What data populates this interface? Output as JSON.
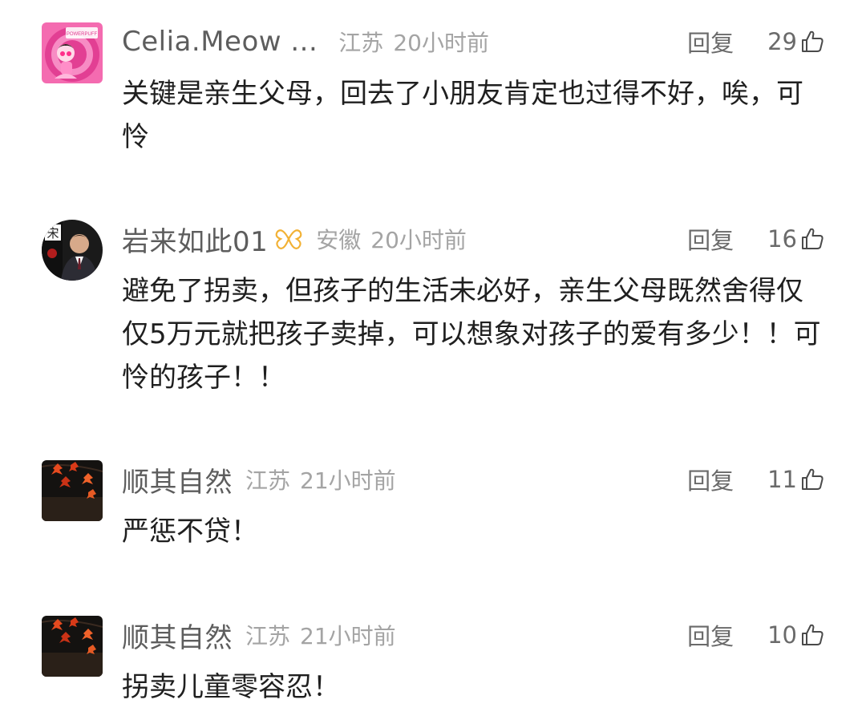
{
  "comments": [
    {
      "username": "Celia.Meow ...",
      "location": "江苏",
      "time": "20小时前",
      "reply_label": "回复",
      "likes": "29",
      "text": "关键是亲生父母，回去了小朋友肯定也过得不好，唉，可怜",
      "avatar": "cartoon-pink-avatar",
      "avatar_text": "POWERPUFF"
    },
    {
      "username": "岩来如此01",
      "badge_icon": "butterfly-badge-icon",
      "location": "安徽",
      "time": "20小时前",
      "reply_label": "回复",
      "likes": "16",
      "text": "避免了拐卖，但孩子的生活未必好，亲生父母既然舍得仅仅5万元就把孩子卖掉，可以想象对孩子的爱有多少！！可怜的孩子！！",
      "avatar": "man-portrait-avatar",
      "avatar_text": "宋"
    },
    {
      "username": "顺其自然",
      "location": "江苏",
      "time": "21小时前",
      "reply_label": "回复",
      "likes": "11",
      "text": "严惩不贷！",
      "avatar": "autumn-leaves-avatar"
    },
    {
      "username": "顺其自然",
      "location": "江苏",
      "time": "21小时前",
      "reply_label": "回复",
      "likes": "10",
      "text": "拐卖儿童零容忍！",
      "avatar": "autumn-leaves-avatar"
    }
  ],
  "colors": {
    "username": "#5d5d5d",
    "meta": "#a4a4a4",
    "text": "#1f1f1f",
    "badge": "#f2b134"
  }
}
